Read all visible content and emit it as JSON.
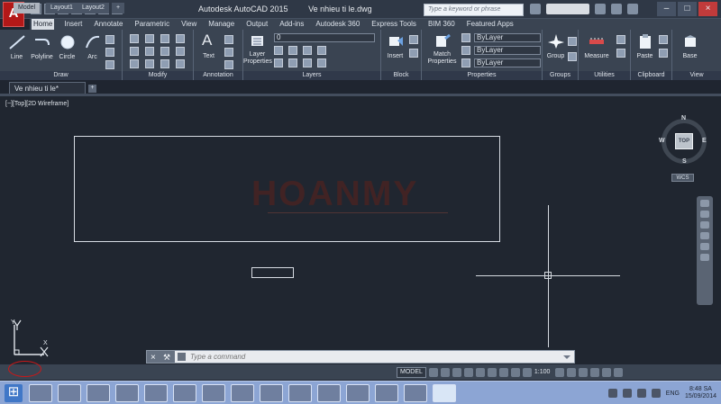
{
  "app": {
    "title": "Autodesk AutoCAD 2015",
    "document_title": "Ve nhieu ti le.dwg",
    "logo": "A",
    "search_placeholder": "Type a keyword or phrase"
  },
  "ribbon": {
    "tabs": [
      "Home",
      "Insert",
      "Annotate",
      "Parametric",
      "View",
      "Manage",
      "Output",
      "Add-ins",
      "Autodesk 360",
      "Express Tools",
      "BIM 360",
      "Featured Apps"
    ],
    "active_tab": "Home",
    "panels": [
      "Draw",
      "Modify",
      "Annotation",
      "Layers",
      "Block",
      "Properties",
      "Groups",
      "Utilities",
      "Clipboard",
      "View"
    ],
    "tools": {
      "line": "Line",
      "polyline": "Polyline",
      "circle": "Circle",
      "arc": "Arc",
      "text": "Text",
      "layer_properties": "Layer Properties",
      "insert": "Insert",
      "match_properties": "Match Properties",
      "group": "Group",
      "measure": "Measure",
      "paste": "Paste",
      "base": "Base"
    },
    "layer_value": "0",
    "property_values": [
      "ByLayer",
      "ByLayer",
      "ByLayer"
    ]
  },
  "file_tab": {
    "name": "Ve nhieu ti le*",
    "new_tab": "+"
  },
  "viewport": {
    "label": "[−][Top][2D Wireframe]",
    "watermark": "HOANMY",
    "viewcube": {
      "top": "TOP",
      "north": "N",
      "south": "S",
      "east": "E",
      "west": "W",
      "wcs": "WCS"
    },
    "ucs": {
      "x": "X",
      "y": "Y"
    }
  },
  "command": {
    "placeholder": "Type a command"
  },
  "layout_tabs": [
    "Model",
    "Layout1",
    "Layout2",
    "+"
  ],
  "status": {
    "model": "MODEL",
    "scale": "1:100"
  },
  "taskbar": {
    "apps": [
      "file-explorer",
      "chrome",
      "excel",
      "word",
      "onenote",
      "game",
      "photos",
      "paint",
      "media",
      "pdf",
      "internet-explorer",
      "documents",
      "game",
      "onenote",
      "autocad"
    ],
    "language": "ENG",
    "time": "8:48 SA",
    "date": "15/09/2014"
  },
  "colors": {
    "background": "#202630",
    "ribbon": "#3a4452",
    "accent": "#b31818",
    "watermark": "#4b2321",
    "taskbar": "#8ca5d4"
  }
}
